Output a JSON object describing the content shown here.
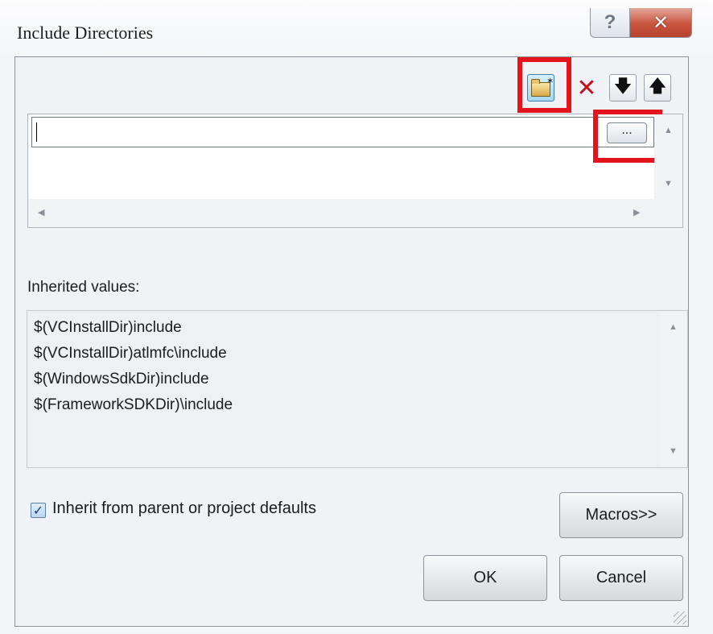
{
  "window": {
    "title": "Include Directories",
    "help_glyph": "?",
    "close_glyph": "✕"
  },
  "toolbar": {
    "new_line_icon": "new-folder-icon",
    "delete_glyph": "✕",
    "move_down_glyph": "🡇",
    "move_up_glyph": "🡅"
  },
  "directories": {
    "current_value": "",
    "browse_label": "...",
    "scroll_up": "▲",
    "scroll_down": "▼",
    "scroll_left": "◀",
    "scroll_right": "▶"
  },
  "inherited": {
    "label": "Inherited values:",
    "items": [
      "$(VCInstallDir)include",
      "$(VCInstallDir)atlmfc\\include",
      "$(WindowsSdkDir)include",
      "$(FrameworkSDKDir)\\include"
    ]
  },
  "options": {
    "inherit_checked": true,
    "inherit_label": "Inherit from parent or project defaults",
    "check_glyph": "✓"
  },
  "buttons": {
    "macros": "Macros>>",
    "ok": "OK",
    "cancel": "Cancel"
  },
  "colors": {
    "highlight": "#e3141c",
    "close_button": "#c9553f"
  }
}
